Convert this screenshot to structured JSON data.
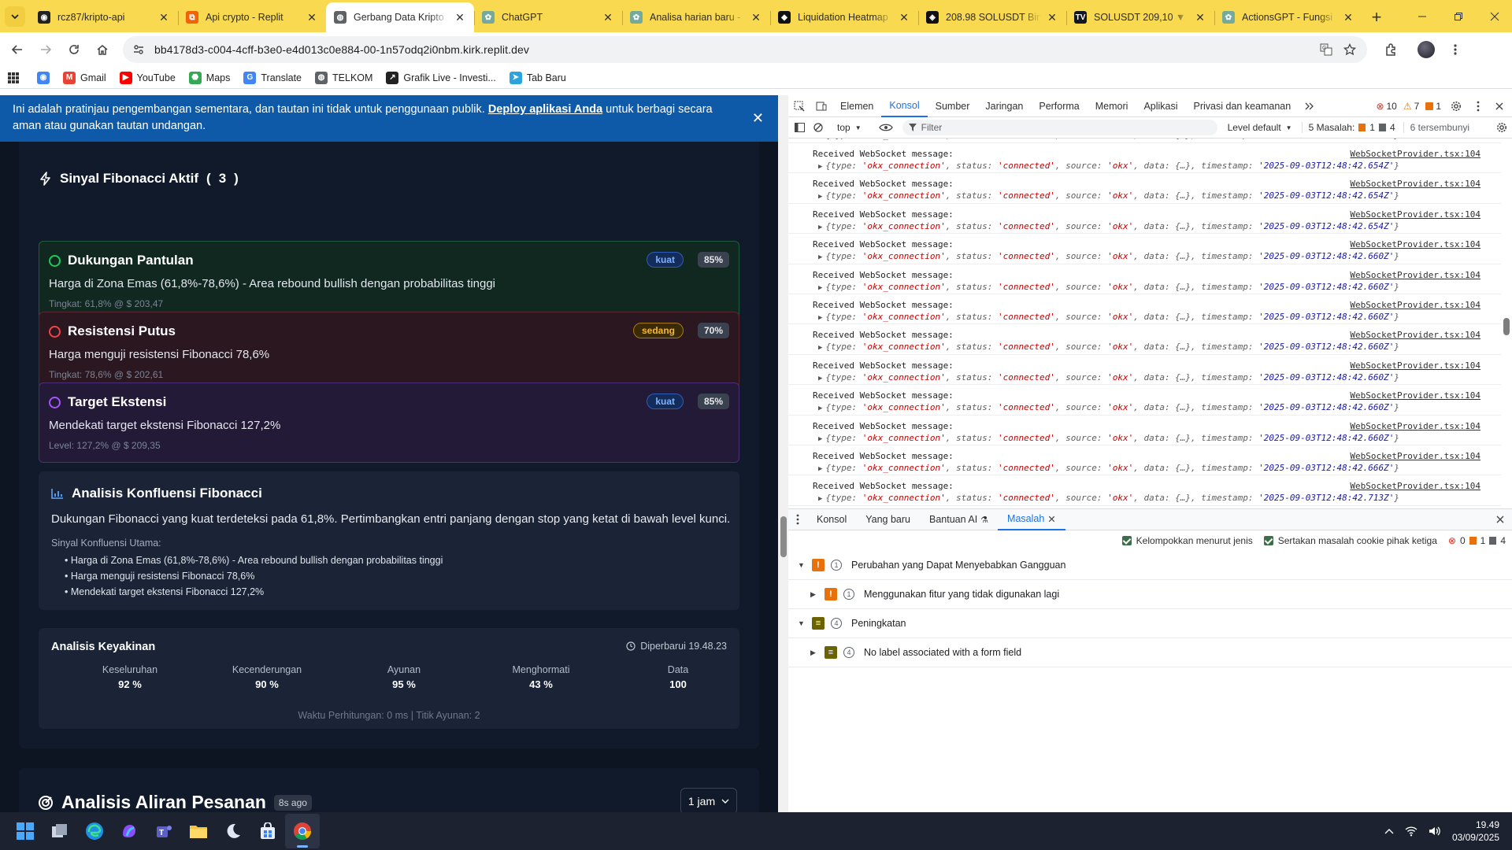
{
  "browser": {
    "tabs": [
      {
        "title": "rcz87/kripto-api",
        "icon": "github-icon"
      },
      {
        "title": "Api crypto - Replit",
        "icon": "replit-icon"
      },
      {
        "title": "Gerbang Data Kripto",
        "icon": "globe-icon",
        "active": true
      },
      {
        "title": "ChatGPT",
        "icon": "openai-icon"
      },
      {
        "title": "Analisa harian baru -",
        "icon": "openai-icon"
      },
      {
        "title": "Liquidation Heatmap",
        "icon": "coinglass-icon"
      },
      {
        "title": "208.98 SOLUSDT Bin",
        "icon": "binance-icon"
      },
      {
        "title": "SOLUSDT 209,10 ▼ -",
        "icon": "tradingview-icon"
      },
      {
        "title": "ActionsGPT - Fungsi",
        "icon": "openai-icon"
      }
    ],
    "url": "bb4178d3-c004-4cff-b3e0-e4d013c0e884-00-1n57odq2i0nbm.kirk.replit.dev",
    "bookmarks": [
      {
        "label": "",
        "icon": "chrome-icon"
      },
      {
        "label": "Gmail",
        "icon": "gmail-icon"
      },
      {
        "label": "YouTube",
        "icon": "youtube-icon"
      },
      {
        "label": "Maps",
        "icon": "maps-icon"
      },
      {
        "label": "Translate",
        "icon": "translate-icon"
      },
      {
        "label": "TELKOM",
        "icon": "globe-icon"
      },
      {
        "label": "Grafik Live - Investi...",
        "icon": "investing-icon"
      },
      {
        "label": "Tab Baru",
        "icon": "telegram-icon"
      }
    ]
  },
  "page": {
    "banner": {
      "pre": "Ini adalah pratinjau pengembangan sementara, dan tautan ini tidak untuk penggunaan publik.",
      "link": "Deploy aplikasi Anda",
      "post": "untuk berbagi secara aman atau gunakan tautan undangan."
    },
    "signals_title": "Sinyal Fibonacci Aktif",
    "signals_count": "3",
    "signals": [
      {
        "title": "Dukungan Pantulan",
        "desc": "Harga di Zona Emas (61,8%-78,6%) - Area rebound bullish dengan probabilitas tinggi",
        "level": "Tingkat: 61,8% @ $ 203,47",
        "badge": "kuat",
        "pct": "85%",
        "color": "#22c55e"
      },
      {
        "title": "Resistensi Putus",
        "desc": "Harga menguji resistensi Fibonacci 78,6%",
        "level": "Tingkat: 78,6% @ $ 202,61",
        "badge": "sedang",
        "pct": "70%",
        "color": "#ef4444"
      },
      {
        "title": "Target Ekstensi",
        "desc": "Mendekati target ekstensi Fibonacci 127,2%",
        "level": "Level: 127,2% @ $ 209,35",
        "badge": "kuat",
        "pct": "85%",
        "color": "#a855f7"
      }
    ],
    "confluence": {
      "title": "Analisis Konfluensi Fibonacci",
      "text": "Dukungan Fibonacci yang kuat terdeteksi pada 61,8%. Pertimbangkan entri panjang dengan stop yang ketat di bawah level kunci.",
      "sub": "Sinyal Konfluensi Utama:",
      "items": [
        "Harga di Zona Emas (61,8%-78,6%) - Area rebound bullish dengan probabilitas tinggi",
        "Harga menguji resistensi Fibonacci 78,6%",
        "Mendekati target ekstensi Fibonacci 127,2%"
      ]
    },
    "confidence": {
      "title": "Analisis Keyakinan",
      "updated": "Diperbarui  19.48.23",
      "stats": [
        {
          "label": "Keseluruhan",
          "value": "92 %"
        },
        {
          "label": "Kecenderungan",
          "value": "90 %"
        },
        {
          "label": "Ayunan",
          "value": "95 %"
        },
        {
          "label": "Menghormati",
          "value": "43 %"
        },
        {
          "label": "Data",
          "value": "100"
        }
      ],
      "footer": "Waktu Perhitungan: 0 ms | Titik Ayunan: 2"
    },
    "orderflow": {
      "title": "Analisis Aliran Pesanan",
      "ago": "8s ago",
      "interval": "1 jam"
    }
  },
  "devtools": {
    "tabs": [
      "Elemen",
      "Konsol",
      "Sumber",
      "Jaringan",
      "Performa",
      "Memori",
      "Aplikasi",
      "Privasi dan keamanan"
    ],
    "active_tab": "Konsol",
    "counts": {
      "errors": "10",
      "warnings": "7",
      "info": "1"
    },
    "context": "top",
    "filter_placeholder": "Filter",
    "level": "Level default",
    "issues_summary": "5 Masalah:",
    "issues_a": "1",
    "issues_b": "4",
    "hidden": "6 tersembunyi",
    "log_label": "Received WebSocket message:",
    "log_source": "WebSocketProvider.tsx:104",
    "log_type": "'okx_connection'",
    "log_status": "'connected'",
    "log_from": "'okx'",
    "log_timestamps": [
      "2025-09-03T12:48:42.654Z",
      "2025-09-03T12:48:42.654Z",
      "2025-09-03T12:48:42.654Z",
      "2025-09-03T12:48:42.654Z",
      "2025-09-03T12:48:42.660Z",
      "2025-09-03T12:48:42.660Z",
      "2025-09-03T12:48:42.660Z",
      "2025-09-03T12:48:42.660Z",
      "2025-09-03T12:48:42.660Z",
      "2025-09-03T12:48:42.660Z",
      "2025-09-03T12:48:42.660Z",
      "2025-09-03T12:48:42.666Z",
      "2025-09-03T12:48:42.713Z"
    ],
    "drawer_tabs": [
      "Konsol",
      "Yang baru",
      "Bantuan AI",
      "Masalah"
    ],
    "drawer_active": "Masalah",
    "group_by": "Kelompokkan menurut jenis",
    "include_cookie": "Sertakan masalah cookie pihak ketiga",
    "issue_counts": {
      "errors": "0",
      "warnings": "1",
      "info": "4"
    },
    "issues": [
      {
        "label": "Perubahan yang Dapat Menyebabkan Gangguan",
        "count": "1",
        "kind": "warning",
        "level": 0
      },
      {
        "label": "Menggunakan fitur yang tidak digunakan lagi",
        "count": "1",
        "kind": "warning",
        "level": 1
      },
      {
        "label": "Peningkatan",
        "count": "4",
        "kind": "info",
        "level": 0
      },
      {
        "label": "No label associated with a form field",
        "count": "4",
        "kind": "info",
        "level": 1
      }
    ]
  },
  "taskbar": {
    "time": "19.49",
    "date": "03/09/2025"
  }
}
